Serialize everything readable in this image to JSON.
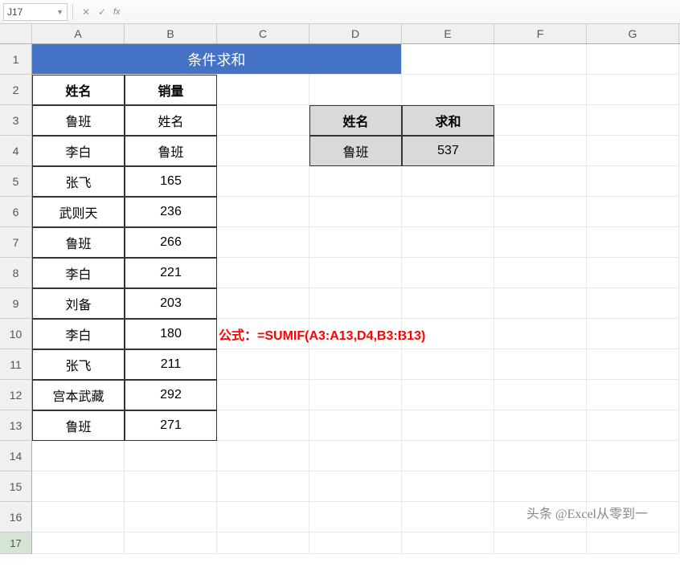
{
  "namebox": "J17",
  "fx_label": "fx",
  "col_headers": [
    "A",
    "B",
    "C",
    "D",
    "E",
    "F",
    "G"
  ],
  "row_headers": [
    "1",
    "2",
    "3",
    "4",
    "5",
    "6",
    "7",
    "8",
    "9",
    "10",
    "11",
    "12",
    "13",
    "14",
    "15",
    "16",
    "17"
  ],
  "title": "条件求和",
  "table": {
    "headers": [
      "姓名",
      "销量"
    ],
    "rows": [
      {
        "a": "鲁班",
        "b": "姓名"
      },
      {
        "a": "李白",
        "b": "鲁班"
      },
      {
        "a": "张飞",
        "b": "165"
      },
      {
        "a": "武则天",
        "b": "236"
      },
      {
        "a": "鲁班",
        "b": "266"
      },
      {
        "a": "李白",
        "b": "221"
      },
      {
        "a": "刘备",
        "b": "203"
      },
      {
        "a": "李白",
        "b": "180"
      },
      {
        "a": "张飞",
        "b": "211"
      },
      {
        "a": "宫本武藏",
        "b": "292"
      },
      {
        "a": "鲁班",
        "b": "271"
      }
    ]
  },
  "side_table": {
    "h1": "姓名",
    "h2": "求和",
    "v1": "鲁班",
    "v2": "537"
  },
  "formula": "公式：=SUMIF(A3:A13,D4,B3:B13)",
  "watermark": "头条 @Excel从零到一"
}
